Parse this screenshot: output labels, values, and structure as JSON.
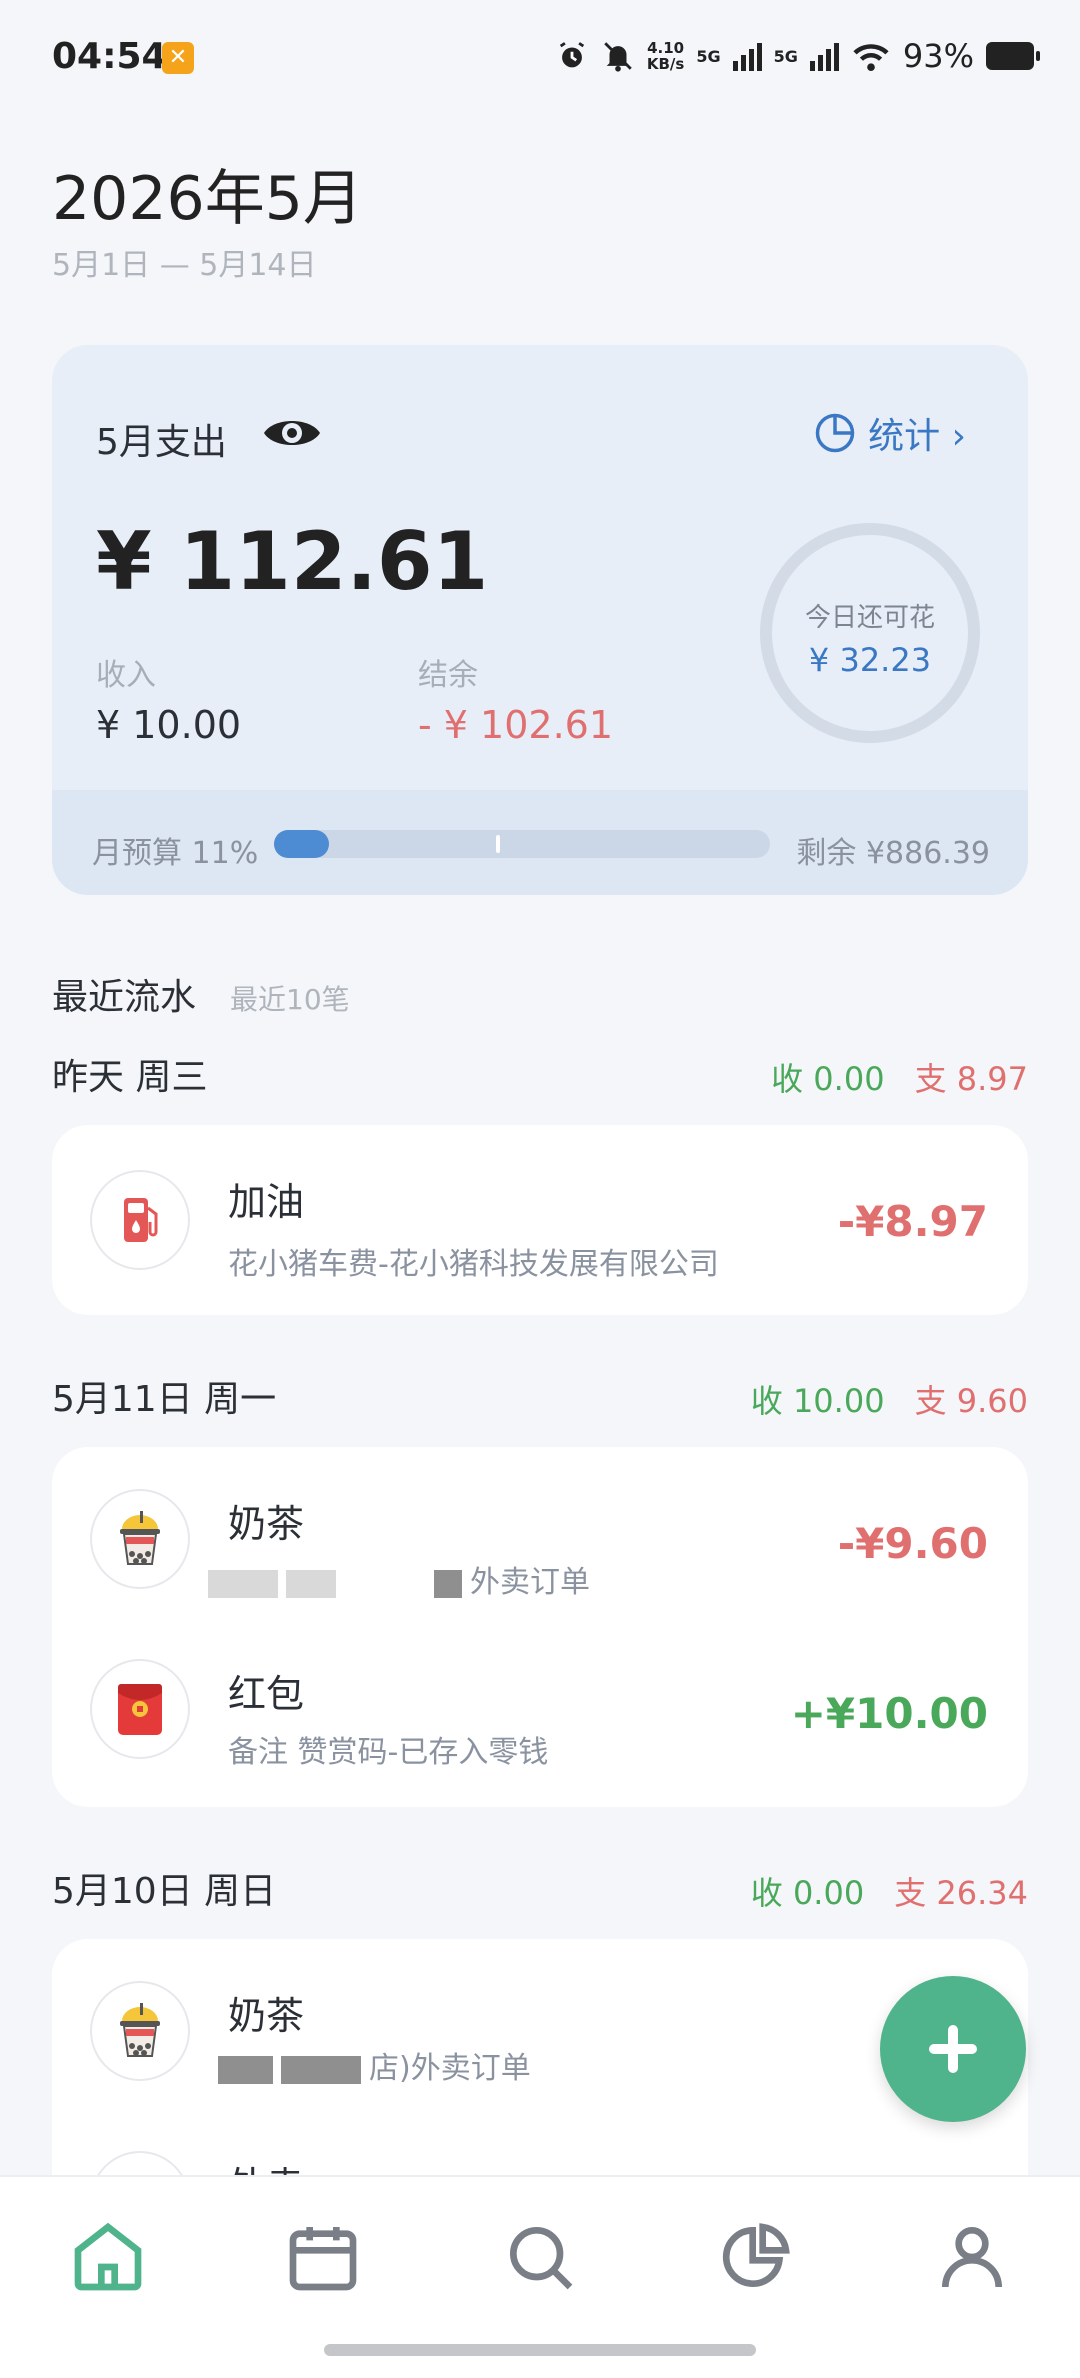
{
  "status_bar": {
    "time": "04:54",
    "net_speed_value": "4.10",
    "net_speed_unit": "KB/s",
    "sim1": "5G",
    "sim2": "5G",
    "battery": "93%"
  },
  "header": {
    "title": "2026年5月",
    "range": "5月1日 — 5月14日"
  },
  "summary": {
    "label": "5月支出",
    "stats_label": "统计 ›",
    "expense": "¥ 112.61",
    "income_label": "收入",
    "income": "¥ 10.00",
    "balance_label": "结余",
    "balance": "- ¥ 102.61",
    "today_label": "今日还可花",
    "today_value": "¥ 32.23",
    "budget_label": "月预算 11%",
    "budget_fraction": 0.11,
    "budget_remaining": "剩余 ¥886.39"
  },
  "recent": {
    "title": "最近流水",
    "subtitle": "最近10笔"
  },
  "days": [
    {
      "label": "昨天 周三",
      "income": "收 0.00",
      "expense": "支 8.97",
      "items": [
        {
          "category": "加油",
          "note": "花小猪车费-花小猪科技发展有限公司",
          "amount": "-¥8.97",
          "icon": "fuel-icon",
          "type": "expense"
        }
      ]
    },
    {
      "label": "5月11日 周一",
      "income": "收 10.00",
      "expense": "支 9.60",
      "items": [
        {
          "category": "奶茶",
          "note": "外卖订单",
          "amount": "-¥9.60",
          "icon": "milk-tea-icon",
          "type": "expense"
        },
        {
          "category": "红包",
          "note": "备注 赞赏码-已存入零钱",
          "amount": "+¥10.00",
          "icon": "red-envelope-icon",
          "type": "income"
        }
      ]
    },
    {
      "label": "5月10日 周日",
      "income": "收 0.00",
      "expense": "支 26.34",
      "items": [
        {
          "category": "奶茶",
          "note": "店)外卖订单",
          "amount": "-¥",
          "icon": "milk-tea-icon",
          "type": "expense"
        },
        {
          "category": "外卖",
          "note": "",
          "amount": "",
          "icon": "takeout-icon",
          "type": "expense"
        }
      ]
    }
  ],
  "nav": [
    "home-icon",
    "calendar-icon",
    "search-icon",
    "statistics-icon",
    "profile-icon"
  ],
  "colors": {
    "accent_blue": "#3a78c4",
    "income_green": "#4aa85a",
    "expense_red": "#e07070",
    "fab_green": "#4fb38c"
  }
}
